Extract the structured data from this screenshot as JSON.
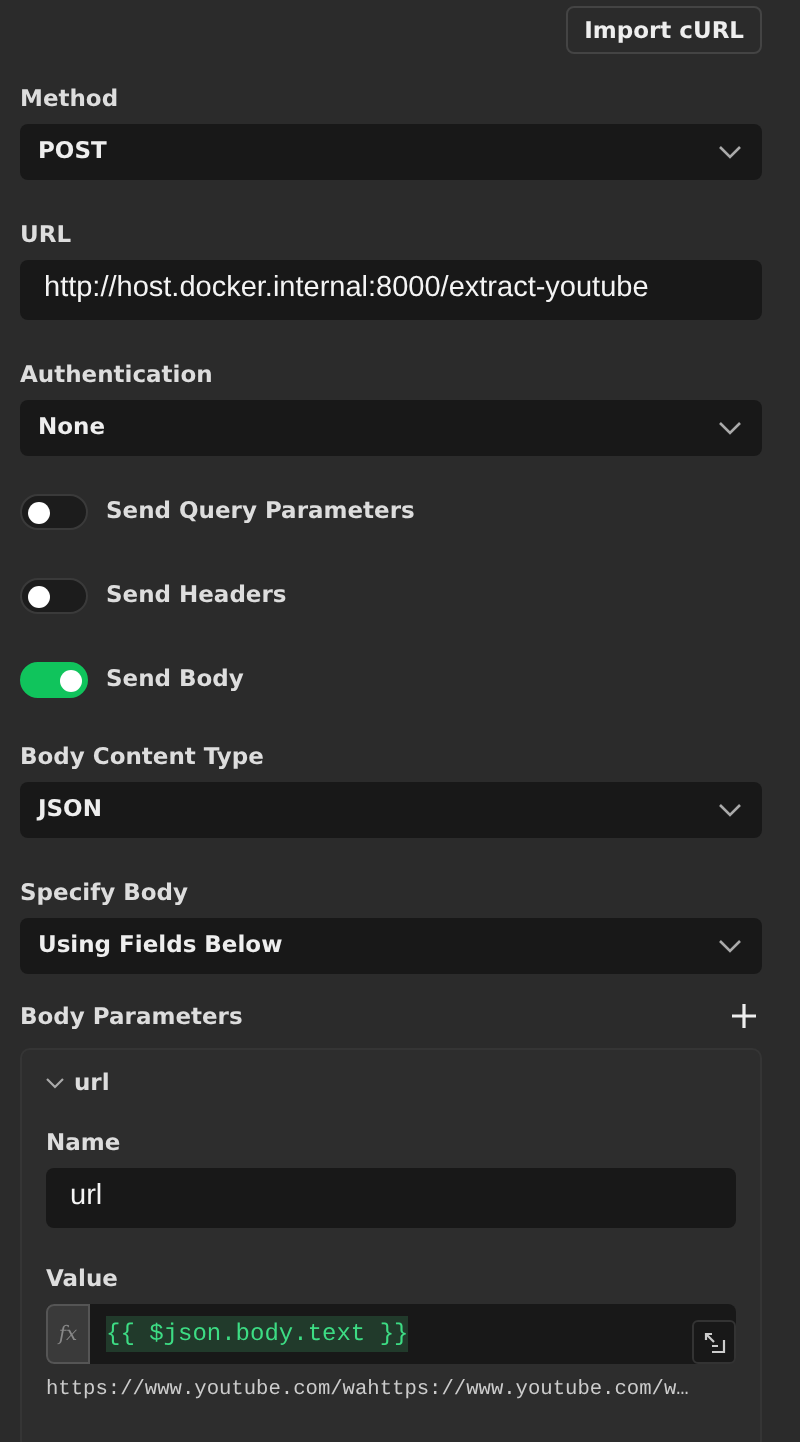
{
  "import_button": "Import cURL",
  "fields": [
    {
      "kind": "select",
      "label": "Method",
      "value": "POST"
    },
    {
      "kind": "input",
      "label": "URL",
      "value": "http://host.docker.internal:8000/extract-youtube"
    },
    {
      "kind": "select",
      "label": "Authentication",
      "value": "None"
    },
    {
      "kind": "toggle",
      "label": "Send Query Parameters",
      "on": false
    },
    {
      "kind": "toggle",
      "label": "Send Headers",
      "on": false
    },
    {
      "kind": "toggle",
      "label": "Send Body",
      "on": true
    },
    {
      "kind": "select",
      "label": "Body Content Type",
      "value": "JSON"
    },
    {
      "kind": "select",
      "label": "Specify Body",
      "value": "Using Fields Below"
    }
  ],
  "body_parameters": {
    "title": "Body Parameters",
    "items": [
      {
        "name": "url",
        "expanded": true,
        "name_label": "Name",
        "name_value": "url",
        "value_label": "Value",
        "fx": "fx",
        "expression": "{{ $json.body.text }}",
        "preview": "https://www.youtube.com/wahttps://www.youtube.com/w…"
      }
    ]
  }
}
